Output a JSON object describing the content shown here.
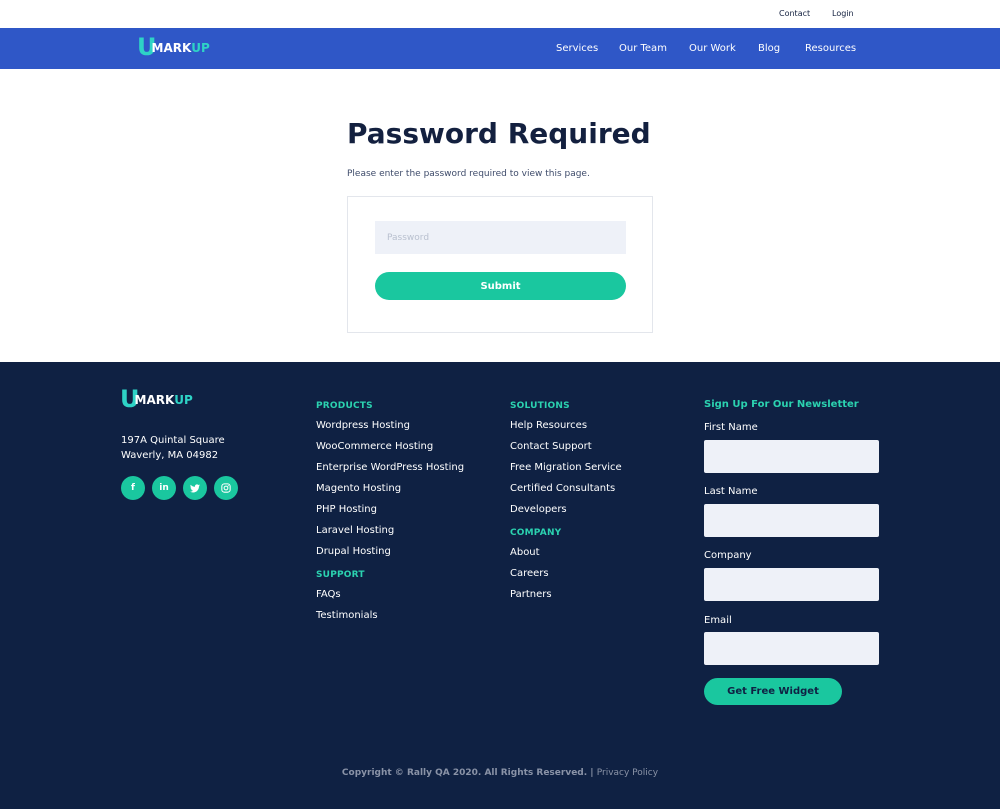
{
  "topbar": {
    "contact": "Contact",
    "login": "Login"
  },
  "brand": {
    "u": "U",
    "mark": "MARK",
    "up": "UP"
  },
  "nav": {
    "items": [
      "Services",
      "Our Team",
      "Our Work",
      "Blog",
      "Resources"
    ]
  },
  "main": {
    "title": "Password Required",
    "subtitle": "Please enter the password required to view this page.",
    "password_placeholder": "Password",
    "submit_label": "Submit"
  },
  "footer": {
    "address_line1": "197A Quintal Square",
    "address_line2": "Waverly, MA 04982",
    "socials": [
      "f",
      "in",
      "t",
      "ig"
    ],
    "products": {
      "heading": "PRODUCTS",
      "links": [
        "Wordpress Hosting",
        "WooCommerce Hosting",
        "Enterprise WordPress Hosting",
        "Magento Hosting",
        "PHP Hosting",
        "Laravel Hosting",
        "Drupal Hosting"
      ]
    },
    "support": {
      "heading": "SUPPORT",
      "links": [
        "FAQs",
        "Testimonials"
      ]
    },
    "solutions": {
      "heading": "SOLUTIONS",
      "links": [
        "Help Resources",
        "Contact Support",
        "Free Migration Service",
        "Certified Consultants",
        "Developers"
      ]
    },
    "company": {
      "heading": "COMPANY",
      "links": [
        "About",
        "Careers",
        "Partners"
      ]
    },
    "newsletter": {
      "heading": "Sign Up For Our Newsletter",
      "first_name": "First Name",
      "last_name": "Last Name",
      "company": "Company",
      "email": "Email",
      "button": "Get Free Widget"
    },
    "copyright": "Copyright © Rally QA 2020. All Rights Reserved. |",
    "privacy": "Privacy Policy"
  },
  "colors": {
    "nav_blue": "#2f57c7",
    "footer_navy": "#0f2143",
    "accent_green": "#1ac79f",
    "logo_teal": "#2ed3c6"
  }
}
